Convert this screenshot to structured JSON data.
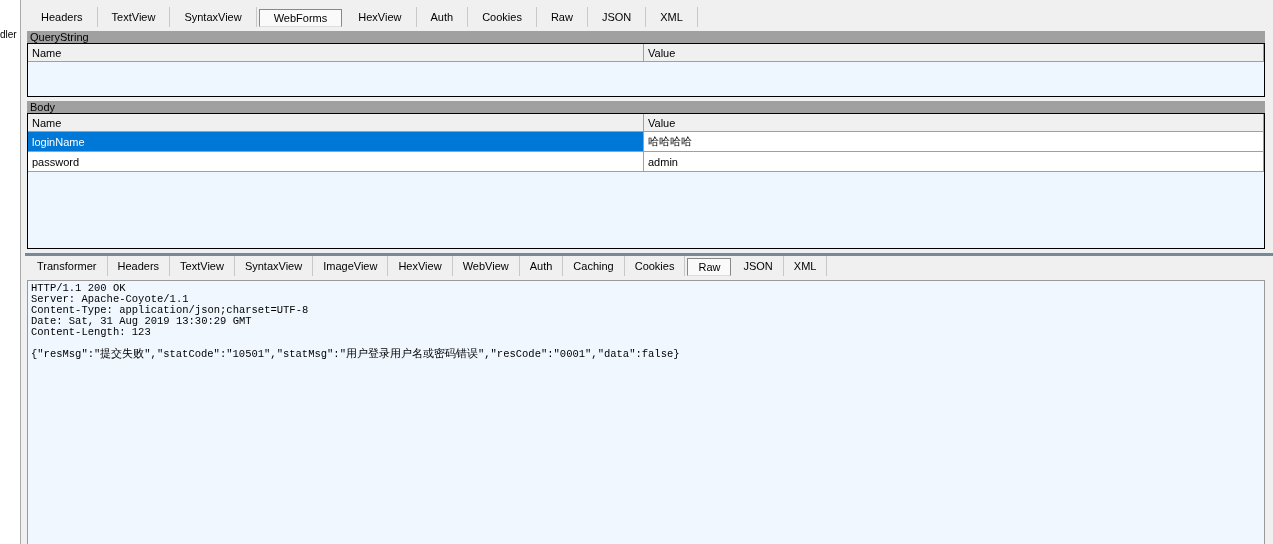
{
  "sidebar": {
    "fragment": "dler"
  },
  "request_tabs": [
    {
      "label": "Headers",
      "selected": false
    },
    {
      "label": "TextView",
      "selected": false
    },
    {
      "label": "SyntaxView",
      "selected": false
    },
    {
      "label": "WebForms",
      "selected": true
    },
    {
      "label": "HexView",
      "selected": false
    },
    {
      "label": "Auth",
      "selected": false
    },
    {
      "label": "Cookies",
      "selected": false
    },
    {
      "label": "Raw",
      "selected": false
    },
    {
      "label": "JSON",
      "selected": false
    },
    {
      "label": "XML",
      "selected": false
    }
  ],
  "query_string": {
    "title": "QueryString",
    "columns": [
      "Name",
      "Value"
    ]
  },
  "body": {
    "title": "Body",
    "columns": [
      "Name",
      "Value"
    ],
    "rows": [
      {
        "name": "loginName",
        "value": "哈哈哈哈",
        "selected": true
      },
      {
        "name": "password",
        "value": "admin",
        "selected": false
      }
    ]
  },
  "response_tabs": [
    {
      "label": "Transformer",
      "selected": false
    },
    {
      "label": "Headers",
      "selected": false
    },
    {
      "label": "TextView",
      "selected": false
    },
    {
      "label": "SyntaxView",
      "selected": false
    },
    {
      "label": "ImageView",
      "selected": false
    },
    {
      "label": "HexView",
      "selected": false
    },
    {
      "label": "WebView",
      "selected": false
    },
    {
      "label": "Auth",
      "selected": false
    },
    {
      "label": "Caching",
      "selected": false
    },
    {
      "label": "Cookies",
      "selected": false
    },
    {
      "label": "Raw",
      "selected": true
    },
    {
      "label": "JSON",
      "selected": false
    },
    {
      "label": "XML",
      "selected": false
    }
  ],
  "raw": {
    "header_lines": [
      "HTTP/1.1 200 OK",
      "Server: Apache-Coyote/1.1",
      "Content-Type: application/json;charset=UTF-8",
      "Date: Sat, 31 Aug 2019 13:30:29 GMT",
      "Content-Length: 123"
    ],
    "body": "{\"resMsg\":\"提交失败\",\"statCode\":\"10501\",\"statMsg\":\"用户登录用户名或密码错误\",\"resCode\":\"0001\",\"data\":false}"
  }
}
